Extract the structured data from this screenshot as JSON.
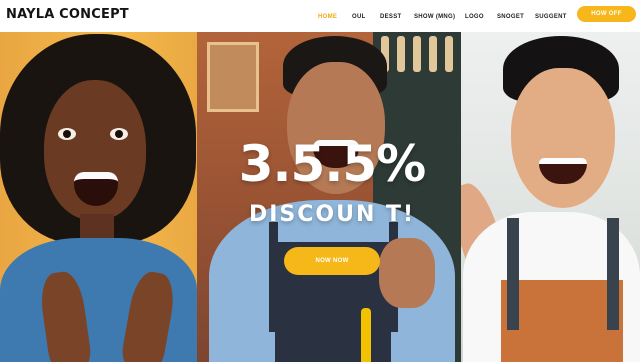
{
  "header": {
    "brand": "NAYLA CONCEPT",
    "nav": [
      {
        "label": "HOME",
        "active": true
      },
      {
        "label": "OUL",
        "active": false
      },
      {
        "label": "DESST",
        "active": false
      },
      {
        "label": "SHOW (MNG)",
        "active": false
      },
      {
        "label": "LOGO",
        "active": false
      },
      {
        "label": "SNOGET",
        "active": false
      },
      {
        "label": "SUGGENT",
        "active": false
      }
    ],
    "cta_label": "HOW OFF"
  },
  "hero": {
    "promo_value": "3.5.5%",
    "promo_label": "DISCOUN T!",
    "button_label": "NOW NOW"
  },
  "colors": {
    "accent": "#f7b71b",
    "active_nav": "#f2a90c"
  }
}
